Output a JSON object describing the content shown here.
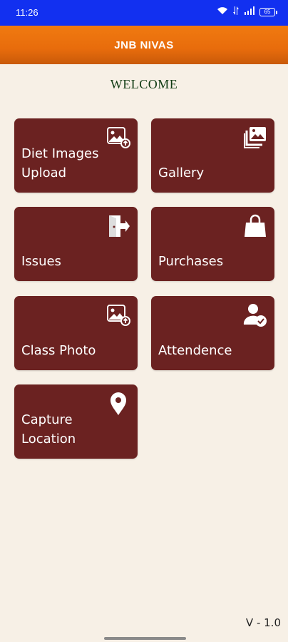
{
  "status_bar": {
    "time": "11:26",
    "icons": [
      "wifi-icon",
      "data-icon",
      "signal-icon",
      "battery-icon"
    ],
    "battery_level": "65"
  },
  "app_bar": {
    "title": "JNB NIVAS"
  },
  "welcome": "WELCOME",
  "tiles": [
    {
      "label": "Diet Images\nUpload",
      "icon": "image-upload-icon"
    },
    {
      "label": "Gallery",
      "icon": "gallery-icon"
    },
    {
      "label": "Issues",
      "icon": "exit-door-icon"
    },
    {
      "label": "Purchases",
      "icon": "shopping-bag-icon"
    },
    {
      "label": "Class Photo",
      "icon": "image-upload-icon"
    },
    {
      "label": "Attendence",
      "icon": "user-check-icon"
    },
    {
      "label": "Capture\nLocation",
      "icon": "location-pin-icon"
    }
  ],
  "version": "V - 1.0",
  "colors": {
    "status_bar": "#1230f0",
    "app_bar": "#e86c0c",
    "tile": "#6b2221",
    "background": "#f7f0e6",
    "welcome": "#0f3a12"
  }
}
